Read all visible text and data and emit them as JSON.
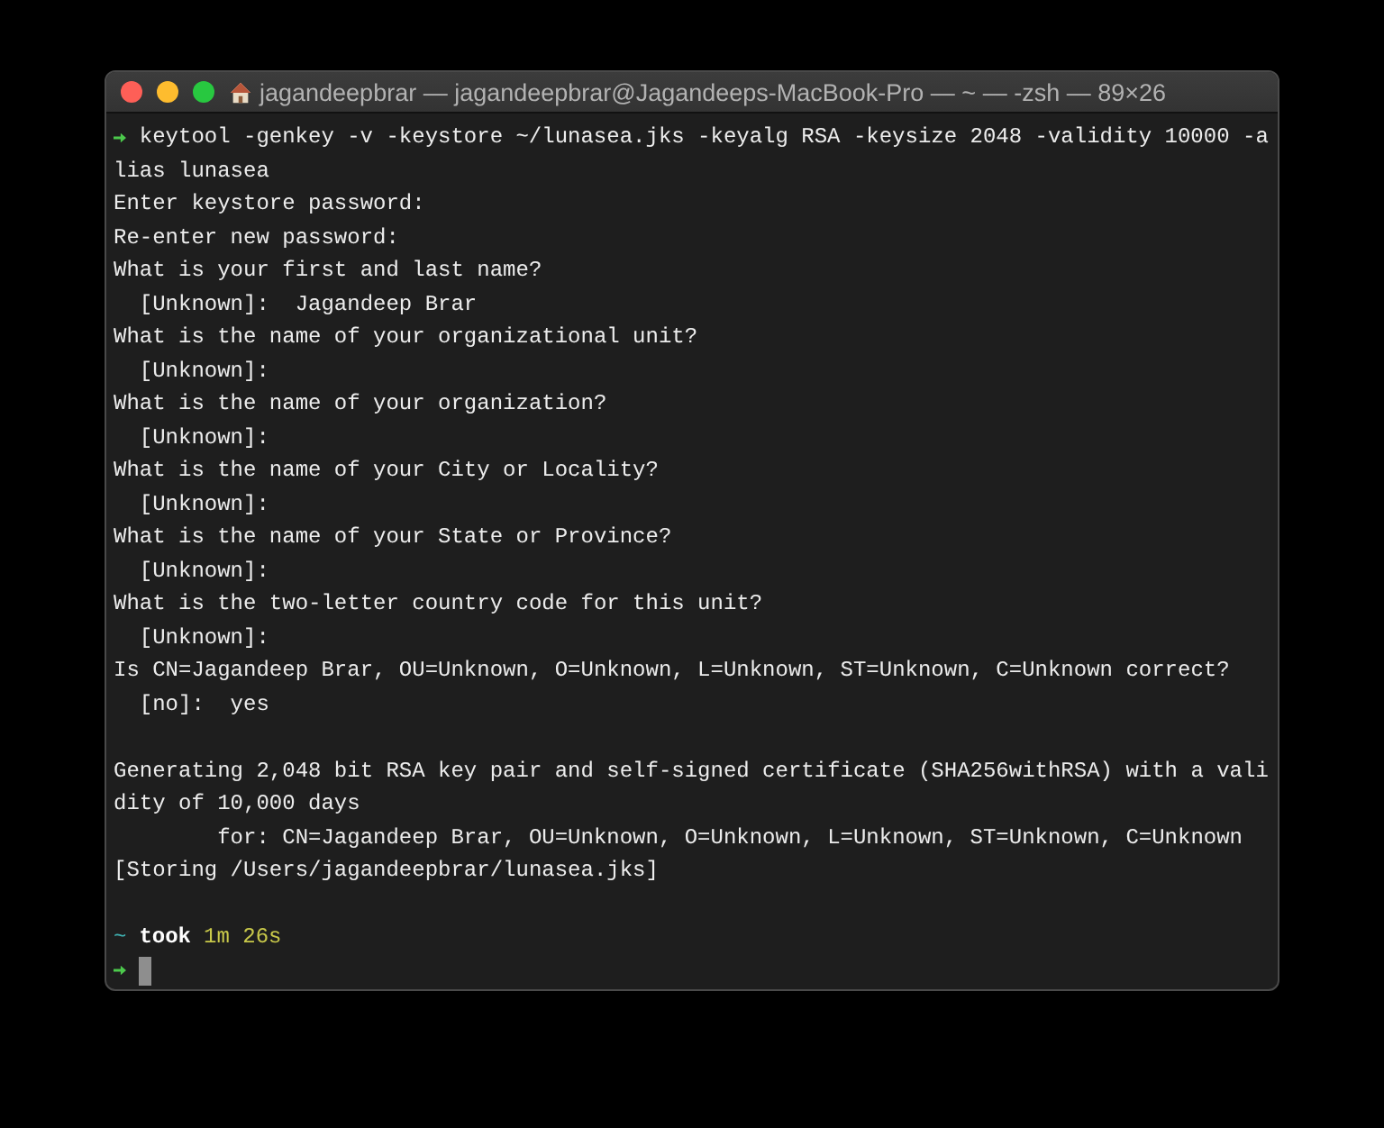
{
  "window": {
    "title": "jagandeepbrar — jagandeepbrar@Jagandeeps-MacBook-Pro — ~ — -zsh — 89×26"
  },
  "lines": [
    {
      "kind": "command",
      "text": "keytool -genkey -v -keystore ~/lunasea.jks -keyalg RSA -keysize 2048 -validity 10000 -a"
    },
    {
      "kind": "text",
      "text": "lias lunasea"
    },
    {
      "kind": "text",
      "text": "Enter keystore password:"
    },
    {
      "kind": "text",
      "text": "Re-enter new password:"
    },
    {
      "kind": "text",
      "text": "What is your first and last name?"
    },
    {
      "kind": "text",
      "text": "  [Unknown]:  Jagandeep Brar"
    },
    {
      "kind": "text",
      "text": "What is the name of your organizational unit?"
    },
    {
      "kind": "text",
      "text": "  [Unknown]:"
    },
    {
      "kind": "text",
      "text": "What is the name of your organization?"
    },
    {
      "kind": "text",
      "text": "  [Unknown]:"
    },
    {
      "kind": "text",
      "text": "What is the name of your City or Locality?"
    },
    {
      "kind": "text",
      "text": "  [Unknown]:"
    },
    {
      "kind": "text",
      "text": "What is the name of your State or Province?"
    },
    {
      "kind": "text",
      "text": "  [Unknown]:"
    },
    {
      "kind": "text",
      "text": "What is the two-letter country code for this unit?"
    },
    {
      "kind": "text",
      "text": "  [Unknown]:"
    },
    {
      "kind": "text",
      "text": "Is CN=Jagandeep Brar, OU=Unknown, O=Unknown, L=Unknown, ST=Unknown, C=Unknown correct?"
    },
    {
      "kind": "text",
      "text": "  [no]:  yes"
    },
    {
      "kind": "blank"
    },
    {
      "kind": "text",
      "text": "Generating 2,048 bit RSA key pair and self-signed certificate (SHA256withRSA) with a vali"
    },
    {
      "kind": "text",
      "text": "dity of 10,000 days"
    },
    {
      "kind": "text",
      "text": "        for: CN=Jagandeep Brar, OU=Unknown, O=Unknown, L=Unknown, ST=Unknown, C=Unknown"
    },
    {
      "kind": "text",
      "text": "[Storing /Users/jagandeepbrar/lunasea.jks]"
    },
    {
      "kind": "blank"
    },
    {
      "kind": "timing",
      "dir": "~",
      "word": "took",
      "duration": "1m 26s"
    },
    {
      "kind": "cursor"
    }
  ]
}
